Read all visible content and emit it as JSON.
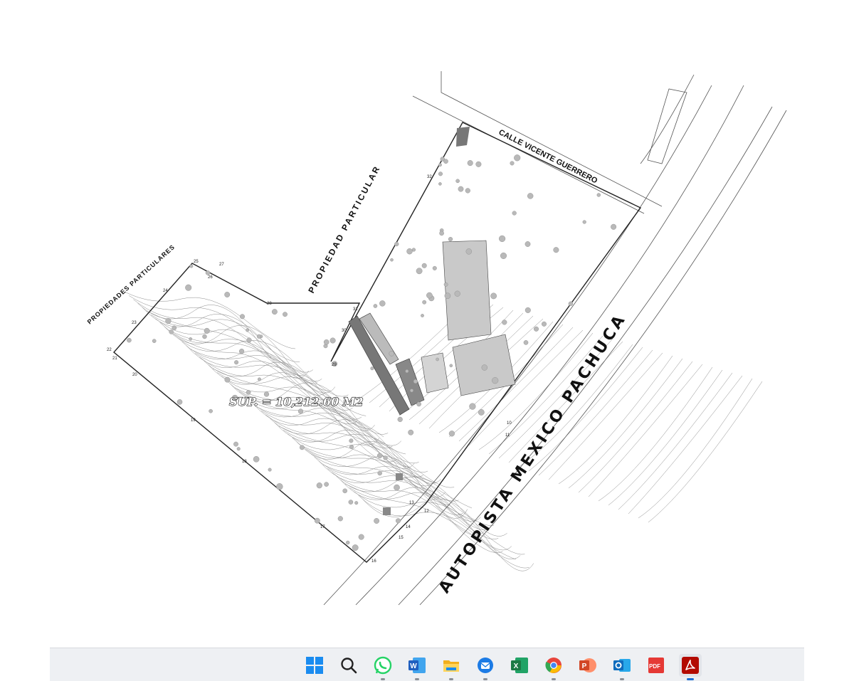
{
  "plan": {
    "surface_label": "SUP. = 10,212.60 M2",
    "street_label": "CALLE VICENTE GUERRERO",
    "highway_label": "AUTOPISTA MEXICO PACHUCA",
    "left_neighbor_label": "PROPIEDADES PARTICULARES",
    "top_neighbor_label": "PROPIEDAD PARTICULAR",
    "vertex_numbers": [
      "10",
      "11",
      "12",
      "13",
      "14",
      "15",
      "16",
      "17",
      "18",
      "19",
      "20",
      "21",
      "22",
      "23",
      "24",
      "25",
      "26",
      "27",
      "28",
      "29",
      "30",
      "31",
      "32"
    ]
  },
  "taskbar": {
    "apps": [
      {
        "name": "start-icon",
        "label": "Start",
        "color": "#1a8cf0"
      },
      {
        "name": "search-icon",
        "label": "Search",
        "color": "#222222"
      },
      {
        "name": "whatsapp-icon",
        "label": "WhatsApp",
        "color": "#25d366"
      },
      {
        "name": "word-icon",
        "label": "Word",
        "color": "#1f5fbf"
      },
      {
        "name": "file-explorer-icon",
        "label": "File Explorer",
        "color": "#f2b01e"
      },
      {
        "name": "thunderbird-icon",
        "label": "Thunderbird",
        "color": "#1c7be5"
      },
      {
        "name": "excel-icon",
        "label": "Excel",
        "color": "#1d7a45"
      },
      {
        "name": "chrome-icon",
        "label": "Chrome",
        "color": "#e8453c"
      },
      {
        "name": "powerpoint-icon",
        "label": "PowerPoint",
        "color": "#d24726"
      },
      {
        "name": "outlook-icon",
        "label": "Outlook",
        "color": "#0f6cbd"
      },
      {
        "name": "pdf-editor-icon",
        "label": "PDF",
        "color": "#e53935"
      },
      {
        "name": "acrobat-icon",
        "label": "Acrobat",
        "color": "#b30b00"
      }
    ]
  }
}
